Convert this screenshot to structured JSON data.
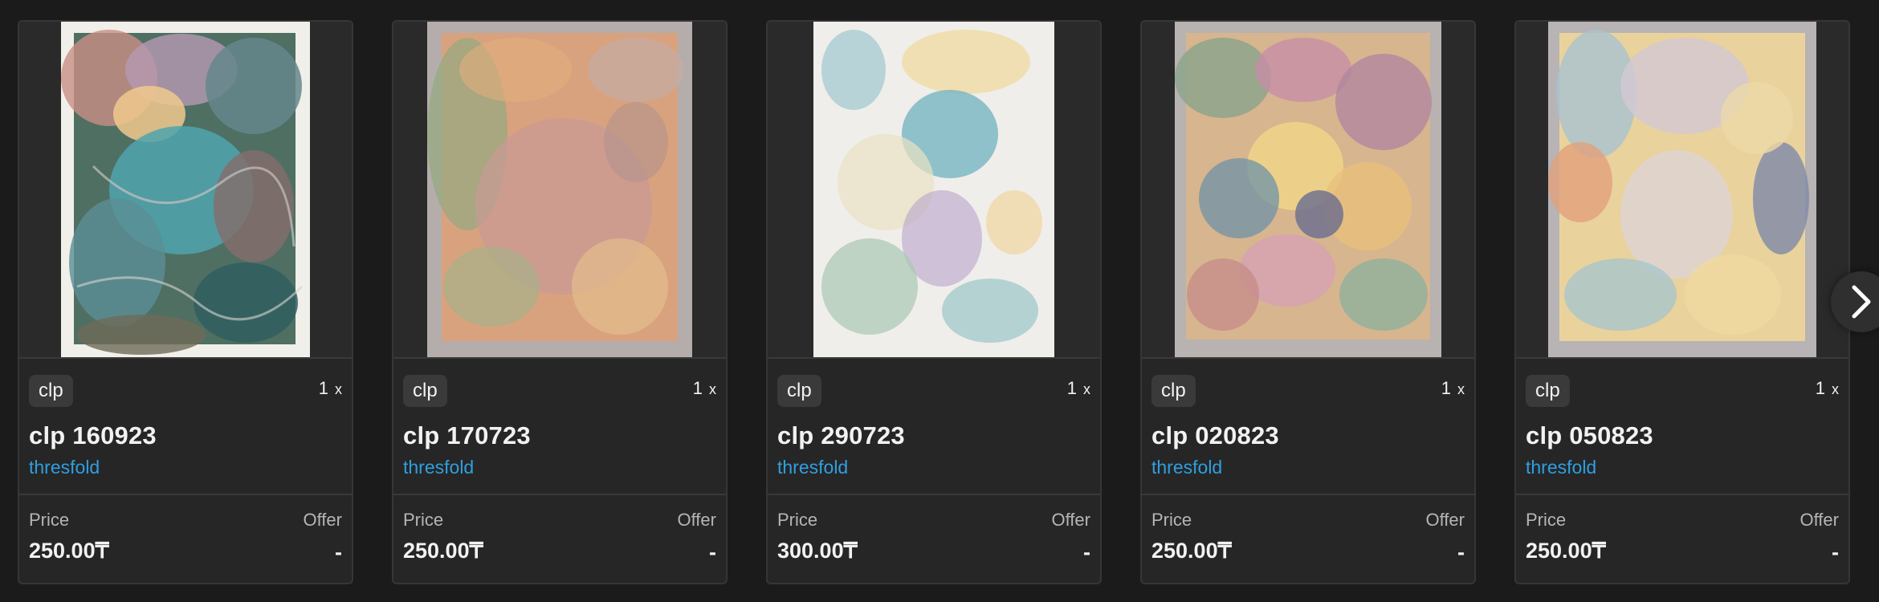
{
  "cards": [
    {
      "tag": "clp",
      "qty": "1",
      "qty_x": "x",
      "title": "clp 160923",
      "artist": "thresfold",
      "price_label": "Price",
      "price": "250.00₸",
      "offer_label": "Offer",
      "offer": "-"
    },
    {
      "tag": "clp",
      "qty": "1",
      "qty_x": "x",
      "title": "clp 170723",
      "artist": "thresfold",
      "price_label": "Price",
      "price": "250.00₸",
      "offer_label": "Offer",
      "offer": "-"
    },
    {
      "tag": "clp",
      "qty": "1",
      "qty_x": "x",
      "title": "clp 290723",
      "artist": "thresfold",
      "price_label": "Price",
      "price": "300.00₸",
      "offer_label": "Offer",
      "offer": "-"
    },
    {
      "tag": "clp",
      "qty": "1",
      "qty_x": "x",
      "title": "clp 020823",
      "artist": "thresfold",
      "price_label": "Price",
      "price": "250.00₸",
      "offer_label": "Offer",
      "offer": "-"
    },
    {
      "tag": "clp",
      "qty": "1",
      "qty_x": "x",
      "title": "clp 050823",
      "artist": "thresfold",
      "price_label": "Price",
      "price": "250.00₸",
      "offer_label": "Offer",
      "offer": "-"
    }
  ],
  "nav": {
    "next_icon": "chevron-right-icon"
  },
  "colors": {
    "background": "#1b1b1b",
    "card": "#262626",
    "artist_link": "#2f9fe0"
  }
}
